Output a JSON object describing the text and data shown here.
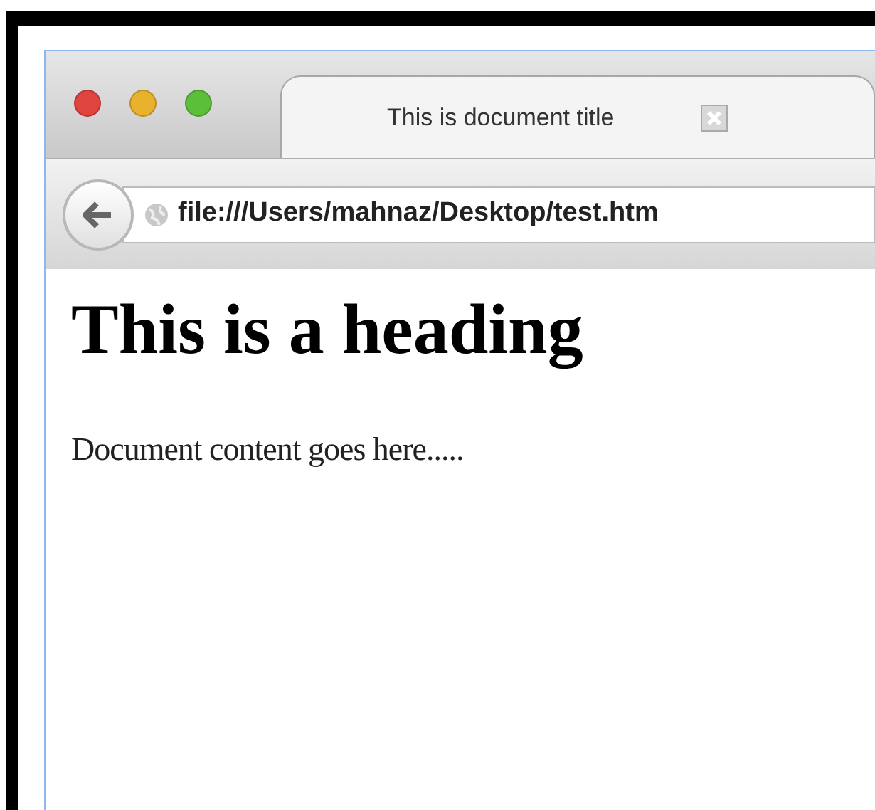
{
  "window": {
    "controls": [
      {
        "color": "#e0443e"
      },
      {
        "color": "#e8b22c"
      },
      {
        "color": "#5cbf3a"
      }
    ]
  },
  "tabs": [
    {
      "label": "This is document title",
      "selected": true
    }
  ],
  "address_bar": {
    "url": "file:///Users/mahnaz/Desktop/test.htm"
  },
  "page": {
    "heading": "This is a heading",
    "paragraph": "Document content goes here....."
  }
}
